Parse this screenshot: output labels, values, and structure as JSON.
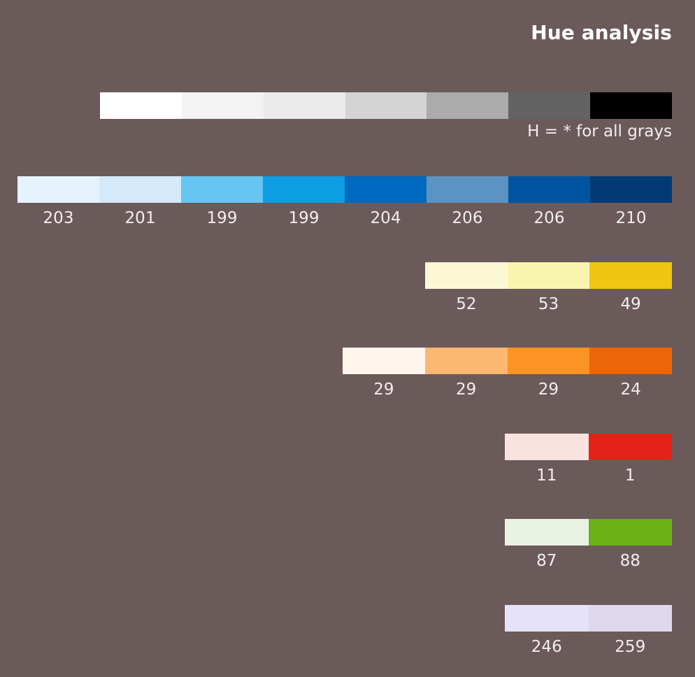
{
  "page": {
    "title": "Hue analysis",
    "background_color": "#6b5a5a",
    "text_color": "#f2eeee"
  },
  "gray_note": "H = * for all grays",
  "chart_data": {
    "type": "bar",
    "title": "Hue analysis",
    "description": "Stacked horizontal color swatch bands with hue (H) values labelled under each swatch",
    "xlabel": "",
    "ylabel": "",
    "rows": [
      {
        "name": "grays",
        "swatches": [
          "#ffffff",
          "#f4f3f3",
          "#eaeaea",
          "#d4d4d4",
          "#ababab",
          "#636363",
          "#000000"
        ],
        "labels": [],
        "note": "H = * for all grays"
      },
      {
        "name": "blues",
        "swatches": [
          "#e6f3fc",
          "#d4e9f9",
          "#66c5f2",
          "#0d9de3",
          "#0069c0",
          "#5d93c2",
          "#00549f",
          "#033a75"
        ],
        "labels": [
          "203",
          "201",
          "199",
          "199",
          "204",
          "206",
          "206",
          "210"
        ]
      },
      {
        "name": "yellows",
        "swatches": [
          "#fcf8d6",
          "#faf5ae",
          "#efc712"
        ],
        "labels": [
          "52",
          "53",
          "49"
        ]
      },
      {
        "name": "oranges",
        "swatches": [
          "#fef5ec",
          "#fcb772",
          "#fc9325",
          "#ec6608"
        ],
        "labels": [
          "29",
          "29",
          "29",
          "24"
        ]
      },
      {
        "name": "reds",
        "swatches": [
          "#f8e3e0",
          "#e42318"
        ],
        "labels": [
          "11",
          "1"
        ]
      },
      {
        "name": "greens",
        "swatches": [
          "#eaf2e3",
          "#6cb018"
        ],
        "labels": [
          "87",
          "88"
        ]
      },
      {
        "name": "purples",
        "swatches": [
          "#e6e2fa",
          "#ded8ef"
        ],
        "labels": [
          "246",
          "259"
        ]
      }
    ]
  }
}
